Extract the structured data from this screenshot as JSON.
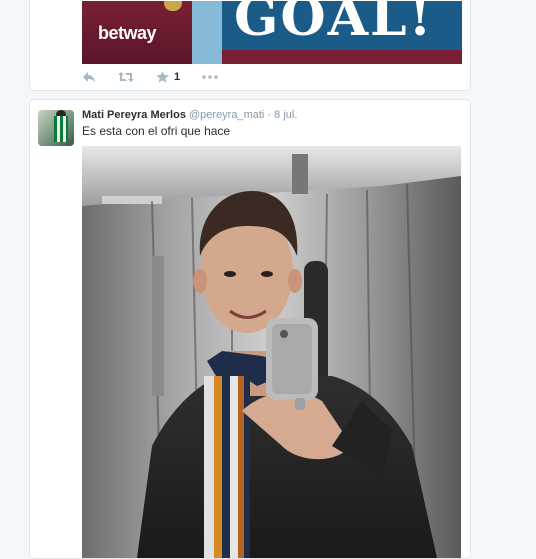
{
  "prev_tweet": {
    "banner": {
      "sponsor": "betway",
      "headline": "GOAL!"
    },
    "actions": {
      "reply_icon": "reply-icon",
      "retweet_icon": "retweet-icon",
      "favorite_icon": "star-icon",
      "favorite_count": "1",
      "more_icon": "more-icon"
    }
  },
  "tweet": {
    "name": "Mati Pereyra Merlos",
    "handle": "@pereyra_mati",
    "separator": "·",
    "time": "8 jul.",
    "text": "Es esta con el ofri que hace",
    "avatar": "user-avatar",
    "media": "elevator-selfie-photo"
  },
  "colors": {
    "background": "#f5f8fa",
    "card_border": "#e1e8ed",
    "text": "#292f33",
    "muted": "#8899a6",
    "action_icon": "#aab8c2"
  }
}
